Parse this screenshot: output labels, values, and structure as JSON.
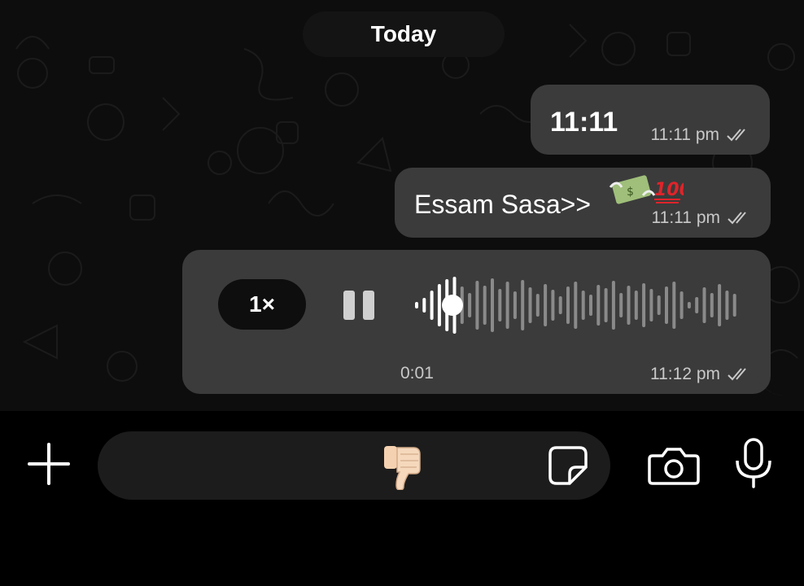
{
  "date_divider": "Today",
  "messages": [
    {
      "text": "11:11",
      "time": "11:11 pm",
      "status": "read"
    },
    {
      "text": "Essam Sasa>>",
      "emoji": "money-with-wings-and-hundred-points",
      "time": "11:11 pm",
      "status": "read"
    },
    {
      "type": "voice-note",
      "speed": "1×",
      "state": "playing",
      "progress": 0.12,
      "duration": "0:01",
      "time": "11:12 pm",
      "status": "read"
    }
  ],
  "composer": {
    "emoji": "thumbs-down",
    "icons": {
      "add": "plus-icon",
      "sticker": "sticker-icon",
      "camera": "camera-icon",
      "mic": "microphone-icon"
    }
  },
  "colors": {
    "bubble": "#3b3b3b",
    "background": "#0d0d0d",
    "meta": "#c9c9c9",
    "composer_field": "#1c1c1c"
  }
}
